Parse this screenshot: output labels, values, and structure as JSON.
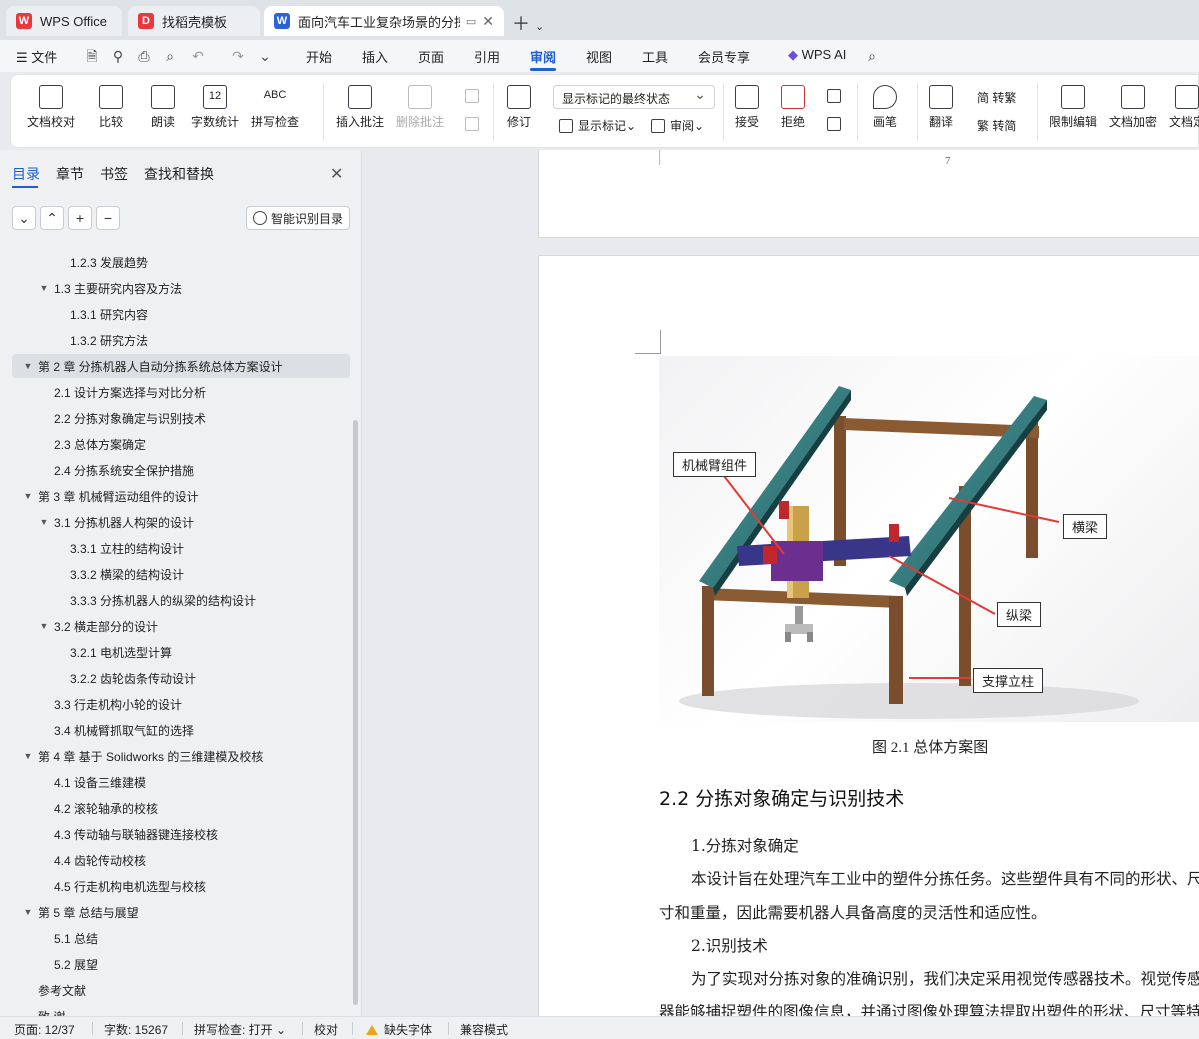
{
  "tabs": [
    {
      "label": "WPS Office",
      "icon": "wps-logo-icon",
      "color": "#e8383d"
    },
    {
      "label": "找稻壳模板",
      "icon": "docer-icon",
      "color": "#e8383d"
    },
    {
      "label": "面向汽车工业复杂场景的分拣",
      "icon": "word-doc-icon",
      "color": "#2b63d9"
    }
  ],
  "menu": {
    "file": "文件",
    "items": [
      "开始",
      "插入",
      "页面",
      "引用",
      "审阅",
      "视图",
      "工具",
      "会员专享"
    ],
    "active": "审阅",
    "wps_ai": "WPS AI"
  },
  "ribbon": {
    "doc_check": "文档校对",
    "compare": "比较",
    "read_aloud": "朗读",
    "word_count": "字数统计",
    "spell_check": "拼写检查",
    "spell_abc": "ABC",
    "word_count_num": "12",
    "insert_comment": "插入批注",
    "delete_comment": "删除批注",
    "revise": "修订",
    "markup_select": "显示标记的最终状态",
    "show_markup": "显示标记",
    "review": "审阅",
    "accept": "接受",
    "reject": "拒绝",
    "pen": "画笔",
    "translate": "翻译",
    "to_traditional": "简 转繁",
    "to_simplified": "繁 转简",
    "restrict_edit": "限制编辑",
    "encrypt": "文档加密",
    "doc_final": "文档定"
  },
  "sidebar": {
    "tabs": [
      "目录",
      "章节",
      "书签",
      "查找和替换"
    ],
    "smart_button": "智能识别目录",
    "toc": [
      {
        "text": "1.2.3  发展趋势",
        "level": 3,
        "arrow": ""
      },
      {
        "text": "1.3  主要研究内容及方法",
        "level": 2,
        "arrow": "▼"
      },
      {
        "text": "1.3.1 研究内容",
        "level": 3,
        "arrow": ""
      },
      {
        "text": "1.3.2 研究方法",
        "level": 3,
        "arrow": ""
      },
      {
        "text": "第 2 章  分拣机器人自动分拣系统总体方案设计",
        "level": 1,
        "arrow": "▼",
        "selected": true
      },
      {
        "text": "2.1  设计方案选择与对比分析",
        "level": 2,
        "arrow": ""
      },
      {
        "text": "2.2  分拣对象确定与识别技术",
        "level": 2,
        "arrow": ""
      },
      {
        "text": "2.3  总体方案确定",
        "level": 2,
        "arrow": ""
      },
      {
        "text": "2.4  分拣系统安全保护措施",
        "level": 2,
        "arrow": ""
      },
      {
        "text": "第 3 章  机械臂运动组件的设计",
        "level": 1,
        "arrow": "▼"
      },
      {
        "text": "3.1 分拣机器人构架的设计",
        "level": 2,
        "arrow": "▼"
      },
      {
        "text": "3.3.1 立柱的结构设计",
        "level": 3,
        "arrow": ""
      },
      {
        "text": "3.3.2 横梁的结构设计",
        "level": 3,
        "arrow": ""
      },
      {
        "text": "3.3.3 分拣机器人的纵梁的结构设计",
        "level": 3,
        "arrow": ""
      },
      {
        "text": "3.2  横走部分的设计",
        "level": 2,
        "arrow": "▼"
      },
      {
        "text": "3.2.1 电机选型计算",
        "level": 3,
        "arrow": ""
      },
      {
        "text": "3.2.2 齿轮齿条传动设计",
        "level": 3,
        "arrow": ""
      },
      {
        "text": "3.3  行走机构小轮的设计",
        "level": 2,
        "arrow": ""
      },
      {
        "text": "3.4  机械臂抓取气缸的选择",
        "level": 2,
        "arrow": ""
      },
      {
        "text": "第 4 章  基于 Solidworks 的三维建模及校核",
        "level": 1,
        "arrow": "▼"
      },
      {
        "text": "4.1  设备三维建模",
        "level": 2,
        "arrow": ""
      },
      {
        "text": "4.2  滚轮轴承的校核",
        "level": 2,
        "arrow": ""
      },
      {
        "text": "4.3 传动轴与联轴器键连接校核",
        "level": 2,
        "arrow": ""
      },
      {
        "text": "4.4  齿轮传动校核",
        "level": 2,
        "arrow": ""
      },
      {
        "text": "4.5  行走机构电机选型与校核",
        "level": 2,
        "arrow": ""
      },
      {
        "text": "第 5 章  总结与展望",
        "level": 1,
        "arrow": "▼"
      },
      {
        "text": "5.1  总结",
        "level": 2,
        "arrow": ""
      },
      {
        "text": "5.2  展望",
        "level": 2,
        "arrow": ""
      },
      {
        "text": "参考文献",
        "level": 1,
        "arrow": ""
      },
      {
        "text": "致  谢",
        "level": 1,
        "arrow": ""
      }
    ]
  },
  "document": {
    "prev_page_number": "7",
    "figure_labels": {
      "arm": "机械臂组件",
      "crossbeam": "横梁",
      "longbeam": "纵梁",
      "column": "支撑立柱"
    },
    "caption": "图 2.1  总体方案图",
    "heading": "2.2  分拣对象确定与识别技术",
    "paragraphs": [
      "1.分拣对象确定",
      "本设计旨在处理汽车工业中的塑件分拣任务。这些塑件具有不同的形状、尺",
      "寸和重量，因此需要机器人具备高度的灵活性和适应性。",
      "2.识别技术",
      "为了实现对分拣对象的准确识别，我们决定采用视觉传感器技术。视觉传感",
      "器能够捕捉塑件的图像信息，并通过图像处理算法提取出塑件的形状、尺寸等特"
    ]
  },
  "status": {
    "page": "页面: 12/37",
    "words": "字数: 15267",
    "spell": "拼写检查: 打开",
    "proofread": "校对",
    "missing_font": "缺失字体",
    "compat": "兼容模式"
  }
}
